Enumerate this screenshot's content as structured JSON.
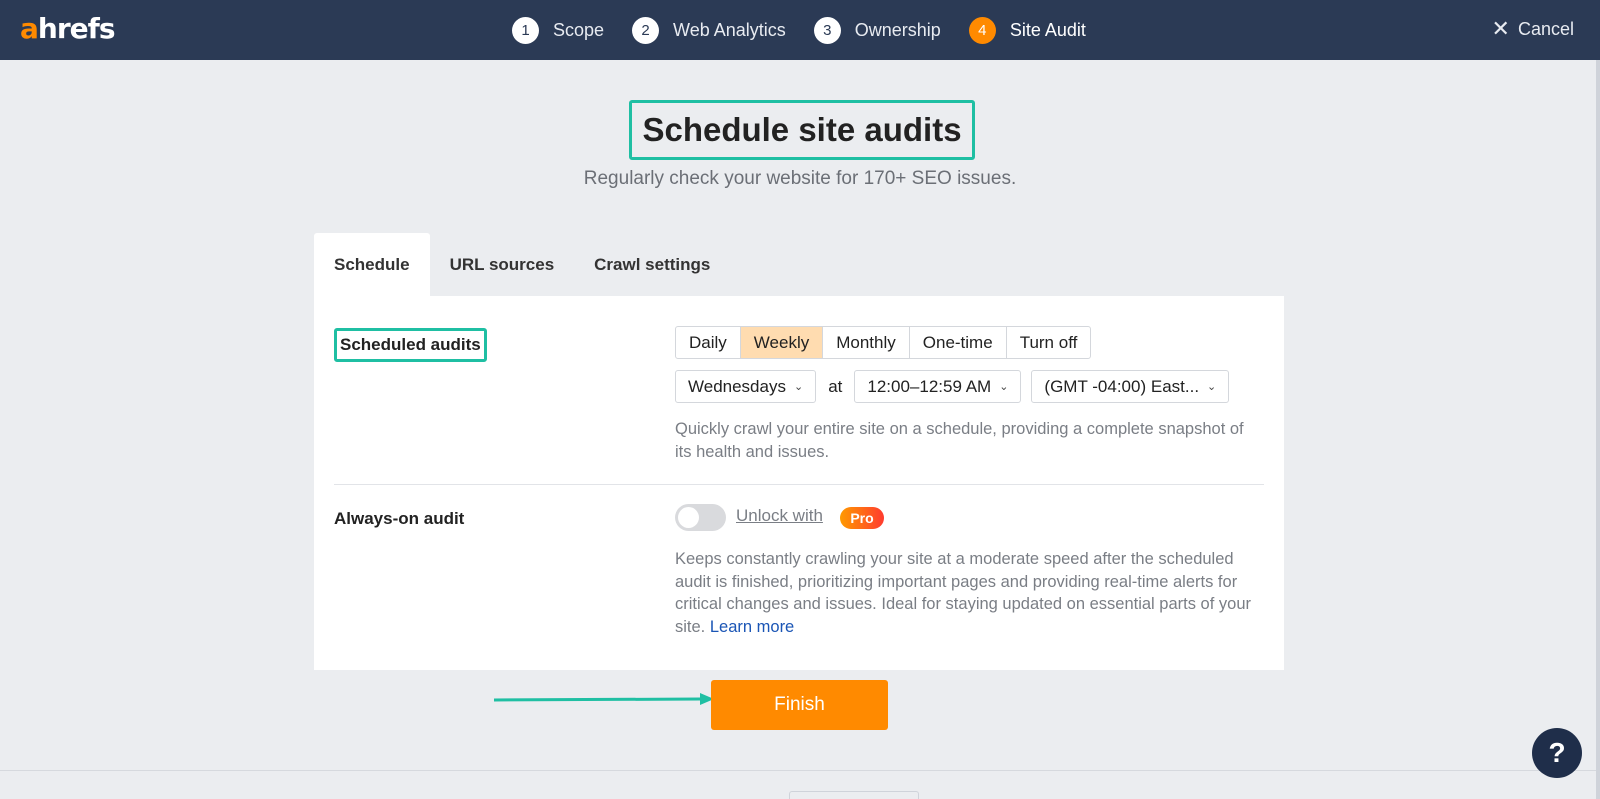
{
  "brand": {
    "logo_accent": "a",
    "logo_rest": "hrefs"
  },
  "steps": [
    {
      "num": "1",
      "label": "Scope"
    },
    {
      "num": "2",
      "label": "Web Analytics"
    },
    {
      "num": "3",
      "label": "Ownership"
    },
    {
      "num": "4",
      "label": "Site Audit"
    }
  ],
  "active_step": 4,
  "cancel": {
    "icon": "close-icon",
    "label": "Cancel"
  },
  "page": {
    "title": "Schedule site audits",
    "subtitle": "Regularly check your website for 170+ SEO issues."
  },
  "tabs": [
    {
      "label": "Schedule"
    },
    {
      "label": "URL sources"
    },
    {
      "label": "Crawl settings"
    }
  ],
  "scheduled": {
    "label": "Scheduled audits",
    "frequency_options": [
      "Daily",
      "Weekly",
      "Monthly",
      "One-time",
      "Turn off"
    ],
    "selected_frequency": "Weekly",
    "day": "Wednesdays",
    "at": "at",
    "time": "12:00–12:59 AM",
    "timezone": "(GMT -04:00) East...",
    "description": "Quickly crawl your entire site on a schedule, providing a complete snapshot of its health and issues."
  },
  "always_on": {
    "label": "Always-on audit",
    "toggle_on": false,
    "unlock_text": "Unlock with",
    "pro_badge": "Pro",
    "description": "Keeps constantly crawling your site at a moderate speed after the scheduled audit is finished, prioritizing important pages and providing real-time alerts for critical changes and issues. Ideal for staying updated on essential parts of your site.",
    "learn_more": "Learn more"
  },
  "finish_label": "Finish",
  "help_label": "?",
  "colors": {
    "topbar": "#2b3a55",
    "accent": "#ff8a00",
    "highlight": "#1fbfa3",
    "link": "#1a55b5"
  }
}
